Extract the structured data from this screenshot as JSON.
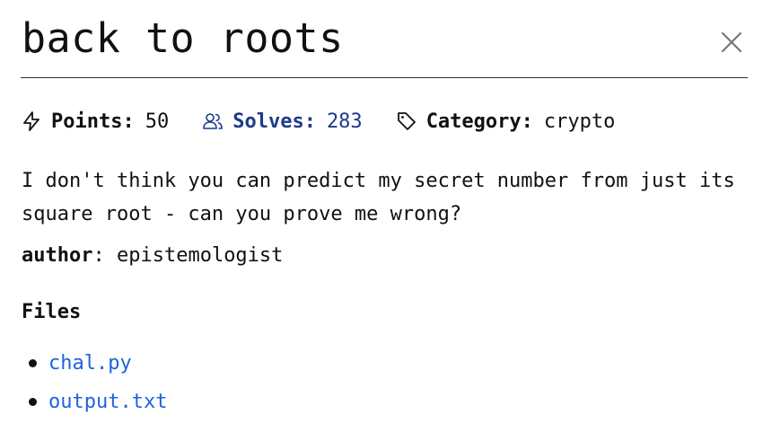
{
  "challenge": {
    "title": "back to roots",
    "points_label": "Points:",
    "points_value": "50",
    "solves_label": "Solves:",
    "solves_value": "283",
    "category_label": "Category:",
    "category_value": "crypto",
    "description": "I don't think you can predict my secret number from just its square root - can you prove me wrong?",
    "author_label": "author",
    "author_value": "epistemologist"
  },
  "files": {
    "heading": "Files",
    "items": [
      {
        "name": "chal.py"
      },
      {
        "name": "output.txt"
      }
    ]
  },
  "colors": {
    "link": "#1d63dc",
    "solves": "#1e3a8a",
    "text": "#111111"
  },
  "icons": {
    "points": "lightning-icon",
    "solves": "users-icon",
    "category": "tag-icon",
    "close": "close-icon"
  }
}
